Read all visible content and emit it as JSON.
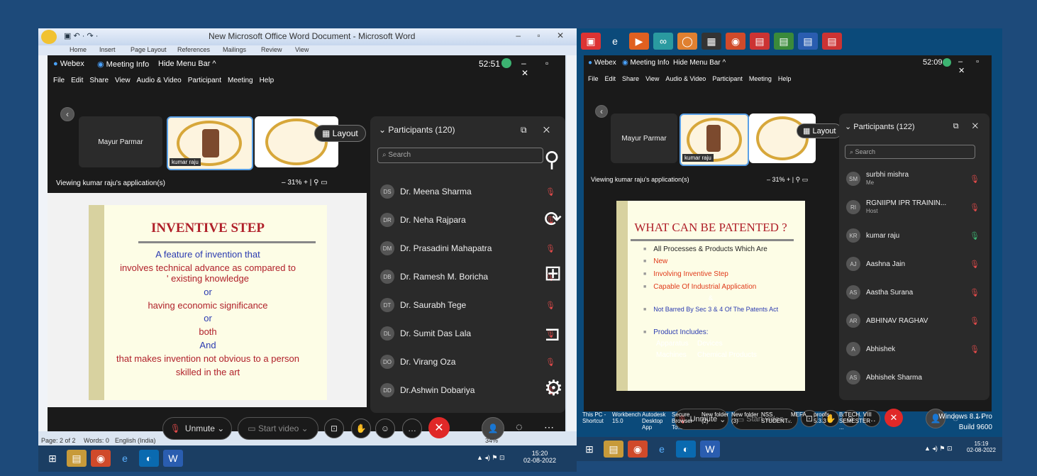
{
  "left": {
    "word_title": "New Microsoft Office Word Document - Microsoft Word",
    "ribbon_tabs": [
      "Home",
      "Insert",
      "Page Layout",
      "References",
      "Mailings",
      "Review",
      "View"
    ],
    "webex": {
      "app": "Webex",
      "meeting_info": "Meeting Info",
      "hide_menu": "Hide Menu Bar ^",
      "timer": "52:51",
      "menu": [
        "File",
        "Edit",
        "Share",
        "View",
        "Audio & Video",
        "Participant",
        "Meeting",
        "Help"
      ],
      "video_name": "Mayur Parmar",
      "thumb_label": "kumar raju",
      "layout_btn": "Layout",
      "viewing": "Viewing kumar raju's application(s)",
      "zoom": "31%",
      "slide": {
        "title": "INVENTIVE STEP",
        "lines": [
          "A feature of invention that",
          "involves technical advance as compared to",
          "' existing knowledge",
          "or",
          "having economic significance",
          "or",
          "both",
          "And",
          "that makes invention not obvious to a person",
          "skilled in the art"
        ]
      },
      "participants_title": "Participants (120)",
      "search_placeholder": "Search",
      "participants": [
        {
          "init": "DS",
          "name": "Dr. Meena Sharma"
        },
        {
          "init": "DR",
          "name": "Dr. Neha Rajpara"
        },
        {
          "init": "DM",
          "name": "Dr. Prasadini Mahapatra"
        },
        {
          "init": "DB",
          "name": "Dr. Ramesh M. Boricha"
        },
        {
          "init": "DT",
          "name": "Dr. Saurabh Tege"
        },
        {
          "init": "DL",
          "name": "Dr. Sumit Das Lala"
        },
        {
          "init": "DO",
          "name": "Dr. Virang Oza"
        },
        {
          "init": "DD",
          "name": "Dr.Ashwin Dobariya"
        }
      ],
      "unmute": "Unmute",
      "start_video": "Start video"
    },
    "status_page": "Page: 2 of 2",
    "status_words": "Words: 0",
    "status_lang": "English (India)",
    "status_zoom": "34%",
    "clock_time": "15:20",
    "clock_date": "02-08-2022"
  },
  "right": {
    "webex": {
      "app": "Webex",
      "meeting_info": "Meeting Info",
      "hide_menu": "Hide Menu Bar ^",
      "timer": "52:09",
      "menu": [
        "File",
        "Edit",
        "Share",
        "View",
        "Audio & Video",
        "Participant",
        "Meeting",
        "Help"
      ],
      "video_name": "Mayur Parmar",
      "thumb_label": "kumar raju",
      "layout_btn": "Layout",
      "viewing": "Viewing kumar raju's application(s)",
      "zoom": "31%",
      "slide": {
        "title": "WHAT CAN BE PATENTED ?",
        "bullets": [
          "All Processes & Products Which Are",
          "New",
          "Involving Inventive Step",
          "Capable Of Industrial Application"
        ],
        "amp": "&",
        "barred": "Not Barred By Sec 3 & 4 Of The Patents Act",
        "includes": "Product Includes:",
        "items": [
          "Apparatus",
          "Devices",
          "Machines",
          "Chemical Products"
        ]
      },
      "participants_title": "Participants (122)",
      "search_placeholder": "Search",
      "participants": [
        {
          "init": "SM",
          "name": "surbhi mishra",
          "sub": "Me"
        },
        {
          "init": "RI",
          "name": "RGNIIPM IPR TRAININ...",
          "sub": "Host"
        },
        {
          "init": "KR",
          "name": "kumar raju",
          "sub": ""
        },
        {
          "init": "AJ",
          "name": "Aashna Jain",
          "sub": ""
        },
        {
          "init": "AS",
          "name": "Aastha Surana",
          "sub": ""
        },
        {
          "init": "AR",
          "name": "ABHINAV RAGHAV",
          "sub": ""
        },
        {
          "init": "A",
          "name": "Abhishek",
          "sub": ""
        },
        {
          "init": "AS",
          "name": "Abhishek Sharma",
          "sub": ""
        }
      ],
      "unmute": "Unmute",
      "start_video": "Start video"
    },
    "desktop_icons": [
      "This PC - Shortcut",
      "Workbench 15.0",
      "Autodesk Desktop App",
      "Secure Browser To...",
      "New folder (2)",
      "New folder (3)",
      "NSS STUDENT...",
      "MEFA",
      "proofs 5.3.3",
      "B.TECH. VIII SEMESTER ..."
    ],
    "os_line1": "Windows 8.1 Pro",
    "os_line2": "Build 9600",
    "clock_time": "15:19",
    "clock_date": "02-08-2022"
  }
}
